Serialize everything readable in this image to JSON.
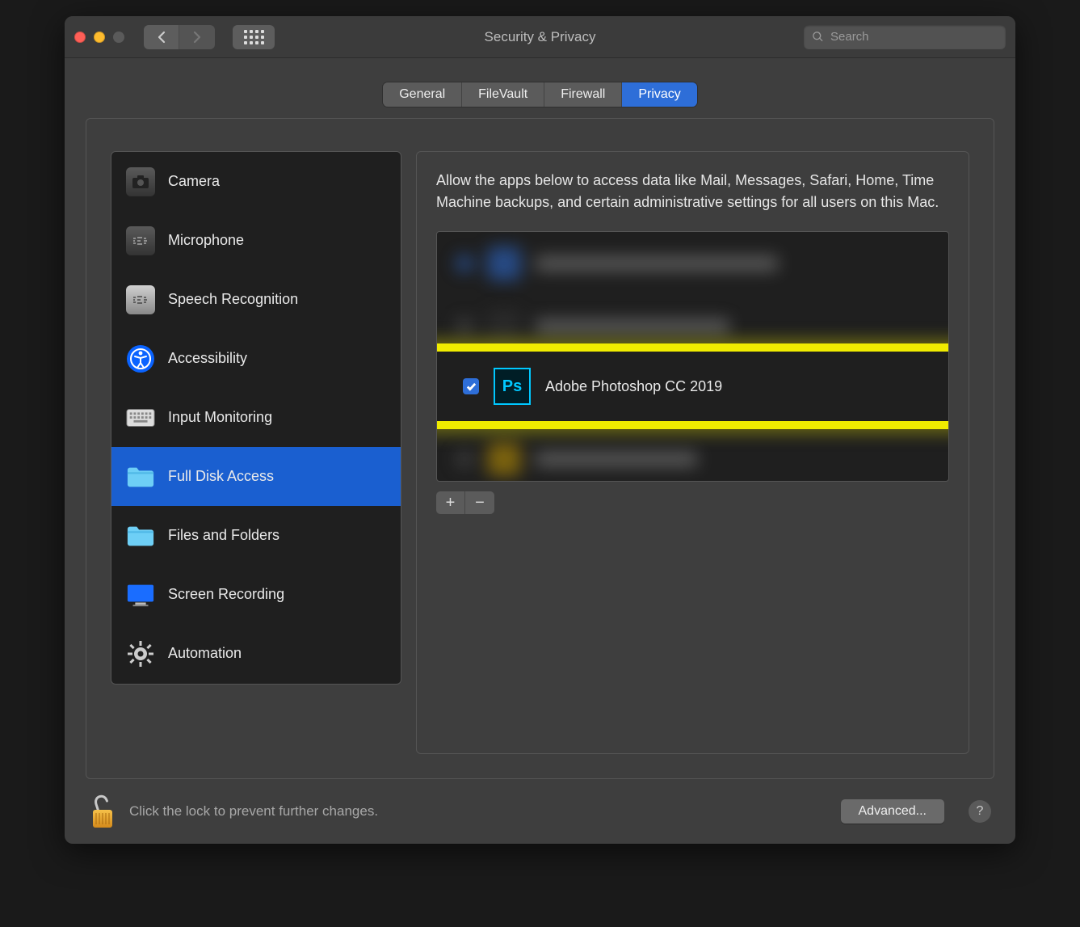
{
  "window": {
    "title": "Security & Privacy",
    "search_placeholder": "Search"
  },
  "tabs": [
    {
      "id": "general",
      "label": "General"
    },
    {
      "id": "filevault",
      "label": "FileVault"
    },
    {
      "id": "firewall",
      "label": "Firewall"
    },
    {
      "id": "privacy",
      "label": "Privacy",
      "active": true
    }
  ],
  "sidebar": {
    "items": [
      {
        "id": "camera",
        "label": "Camera"
      },
      {
        "id": "microphone",
        "label": "Microphone"
      },
      {
        "id": "speech",
        "label": "Speech Recognition"
      },
      {
        "id": "accessibility",
        "label": "Accessibility"
      },
      {
        "id": "input",
        "label": "Input Monitoring"
      },
      {
        "id": "fulldisk",
        "label": "Full Disk Access",
        "selected": true
      },
      {
        "id": "files",
        "label": "Files and Folders"
      },
      {
        "id": "screen",
        "label": "Screen Recording"
      },
      {
        "id": "automation",
        "label": "Automation"
      }
    ]
  },
  "right": {
    "description": "Allow the apps below to access data like Mail, Messages, Safari, Home, Time Machine backups, and certain administrative settings for all users on this Mac.",
    "highlighted_app": {
      "name": "Adobe Photoshop CC 2019",
      "checked": true,
      "icon_label": "Ps"
    },
    "add_label": "+",
    "remove_label": "−"
  },
  "footer": {
    "lock_text": "Click the lock to prevent further changes.",
    "advanced_label": "Advanced...",
    "help_label": "?"
  }
}
